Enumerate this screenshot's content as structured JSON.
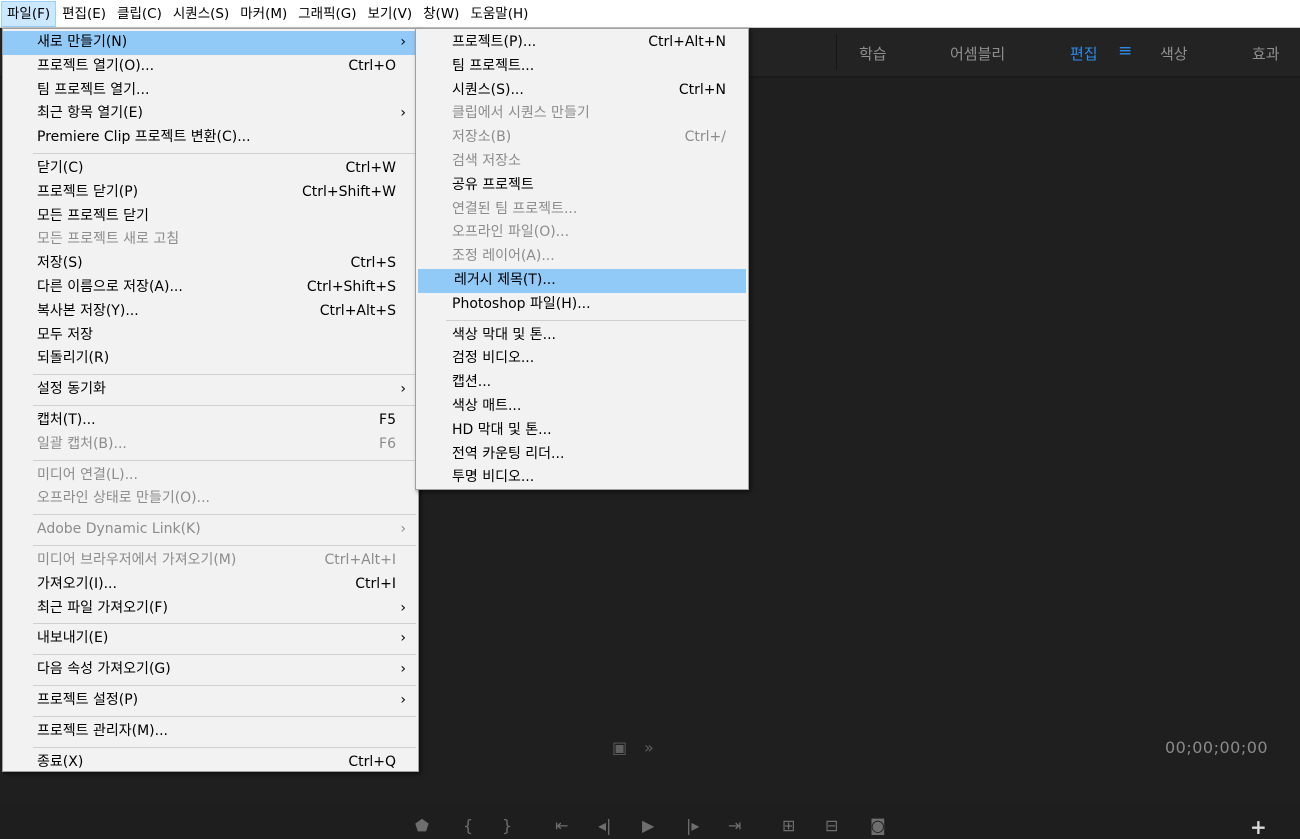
{
  "menubar": [
    "파일(F)",
    "편집(E)",
    "클립(C)",
    "시퀀스(S)",
    "마커(M)",
    "그래픽(G)",
    "보기(V)",
    "창(W)",
    "도움말(H)"
  ],
  "workspaces": [
    "학습",
    "어셈블리",
    "편집",
    "색상",
    "효과"
  ],
  "workspace_menu_icon": "hamburger-icon",
  "timecode": "00;00;00;00",
  "file_menu": [
    {
      "label": "새로 만들기(N)",
      "shortcut": "",
      "submenu": true,
      "state": "highlighted"
    },
    {
      "label": "프로젝트 열기(O)...",
      "shortcut": "Ctrl+O"
    },
    {
      "label": "팀 프로젝트 열기...",
      "shortcut": ""
    },
    {
      "label": "최근 항목 열기(E)",
      "shortcut": "",
      "submenu": true
    },
    {
      "label": "Premiere Clip 프로젝트 변환(C)...",
      "shortcut": ""
    },
    {
      "sep": true
    },
    {
      "label": "닫기(C)",
      "shortcut": "Ctrl+W"
    },
    {
      "label": "프로젝트 닫기(P)",
      "shortcut": "Ctrl+Shift+W"
    },
    {
      "label": "모든 프로젝트 닫기",
      "shortcut": ""
    },
    {
      "label": "모든 프로젝트 새로 고침",
      "shortcut": "",
      "state": "disabled"
    },
    {
      "label": "저장(S)",
      "shortcut": "Ctrl+S"
    },
    {
      "label": "다른 이름으로 저장(A)...",
      "shortcut": "Ctrl+Shift+S"
    },
    {
      "label": "복사본 저장(Y)...",
      "shortcut": "Ctrl+Alt+S"
    },
    {
      "label": "모두 저장",
      "shortcut": ""
    },
    {
      "label": "되돌리기(R)",
      "shortcut": ""
    },
    {
      "sep": true
    },
    {
      "label": "설정 동기화",
      "shortcut": "",
      "submenu": true
    },
    {
      "sep": true
    },
    {
      "label": "캡처(T)...",
      "shortcut": "F5"
    },
    {
      "label": "일괄 캡처(B)...",
      "shortcut": "F6",
      "state": "disabled"
    },
    {
      "sep": true
    },
    {
      "label": "미디어 연결(L)...",
      "shortcut": "",
      "state": "disabled"
    },
    {
      "label": "오프라인 상태로 만들기(O)...",
      "shortcut": "",
      "state": "disabled"
    },
    {
      "sep": true
    },
    {
      "label": "Adobe Dynamic Link(K)",
      "shortcut": "",
      "submenu": true,
      "state": "disabled"
    },
    {
      "sep": true
    },
    {
      "label": "미디어 브라우저에서 가져오기(M)",
      "shortcut": "Ctrl+Alt+I",
      "state": "disabled"
    },
    {
      "label": "가져오기(I)...",
      "shortcut": "Ctrl+I"
    },
    {
      "label": "최근 파일 가져오기(F)",
      "shortcut": "",
      "submenu": true
    },
    {
      "sep": true
    },
    {
      "label": "내보내기(E)",
      "shortcut": "",
      "submenu": true
    },
    {
      "sep": true
    },
    {
      "label": "다음 속성 가져오기(G)",
      "shortcut": "",
      "submenu": true
    },
    {
      "sep": true
    },
    {
      "label": "프로젝트 설정(P)",
      "shortcut": "",
      "submenu": true
    },
    {
      "sep": true
    },
    {
      "label": "프로젝트 관리자(M)...",
      "shortcut": ""
    },
    {
      "sep": true
    },
    {
      "label": "종료(X)",
      "shortcut": "Ctrl+Q"
    }
  ],
  "new_submenu": [
    {
      "label": "프로젝트(P)...",
      "shortcut": "Ctrl+Alt+N"
    },
    {
      "label": "팀 프로젝트...",
      "shortcut": ""
    },
    {
      "label": "시퀀스(S)...",
      "shortcut": "Ctrl+N"
    },
    {
      "label": "클립에서 시퀀스 만들기",
      "shortcut": "",
      "state": "disabled"
    },
    {
      "label": "저장소(B)",
      "shortcut": "Ctrl+/",
      "state": "disabled"
    },
    {
      "label": "검색 저장소",
      "shortcut": "",
      "state": "disabled"
    },
    {
      "label": "공유 프로젝트",
      "shortcut": ""
    },
    {
      "label": "연결된 팀 프로젝트...",
      "shortcut": "",
      "state": "disabled"
    },
    {
      "label": "오프라인 파일(O)...",
      "shortcut": "",
      "state": "disabled"
    },
    {
      "label": "조정 레이어(A)...",
      "shortcut": "",
      "state": "disabled"
    },
    {
      "label": "레거시 제목(T)...",
      "shortcut": "",
      "state": "highlighted"
    },
    {
      "label": "Photoshop 파일(H)...",
      "shortcut": ""
    },
    {
      "sep": true
    },
    {
      "label": "색상 막대 및 톤...",
      "shortcut": ""
    },
    {
      "label": "검정 비디오...",
      "shortcut": ""
    },
    {
      "label": "캡션...",
      "shortcut": ""
    },
    {
      "label": "색상 매트...",
      "shortcut": ""
    },
    {
      "label": "HD 막대 및 톤...",
      "shortcut": ""
    },
    {
      "label": "전역 카운팅 리더...",
      "shortcut": ""
    },
    {
      "label": "투명 비디오...",
      "shortcut": ""
    }
  ],
  "icons": {
    "submenu_arrow": "›",
    "add_button": "+"
  },
  "colors": {
    "accent": "#2d8ceb",
    "menu_bg": "#f2f2f2",
    "highlight": "#91c9f7",
    "disabled_text": "#8c8c8c",
    "app_bg": "#232323"
  }
}
